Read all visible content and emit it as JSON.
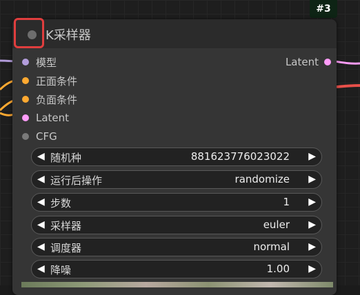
{
  "node": {
    "badge": "#3",
    "title": "K采样器",
    "inputs": [
      {
        "label": "模型",
        "color": "#b39ddb"
      },
      {
        "label": "正面条件",
        "color": "#ffa931"
      },
      {
        "label": "负面条件",
        "color": "#ffa931"
      },
      {
        "label": "Latent",
        "color": "#ff9cf9"
      },
      {
        "label": "CFG",
        "color": "#7a7a7a"
      }
    ],
    "outputs": [
      {
        "label": "Latent",
        "color": "#ff9cf9"
      }
    ],
    "widgets": [
      {
        "label": "随机种",
        "value": "881623776023022"
      },
      {
        "label": "运行后操作",
        "value": "randomize"
      },
      {
        "label": "步数",
        "value": "1"
      },
      {
        "label": "采样器",
        "value": "euler"
      },
      {
        "label": "调度器",
        "value": "normal"
      },
      {
        "label": "降噪",
        "value": "1.00"
      }
    ]
  },
  "colors": {
    "highlight": "#e03e3e",
    "link_model": "#b39ddb",
    "link_conditioning": "#ffa931",
    "link_latent": "#ff9cf9",
    "link_output_red": "#e8504a"
  },
  "icons": {
    "decrement": "triangle-left",
    "increment": "triangle-right",
    "collapse": "circle"
  }
}
